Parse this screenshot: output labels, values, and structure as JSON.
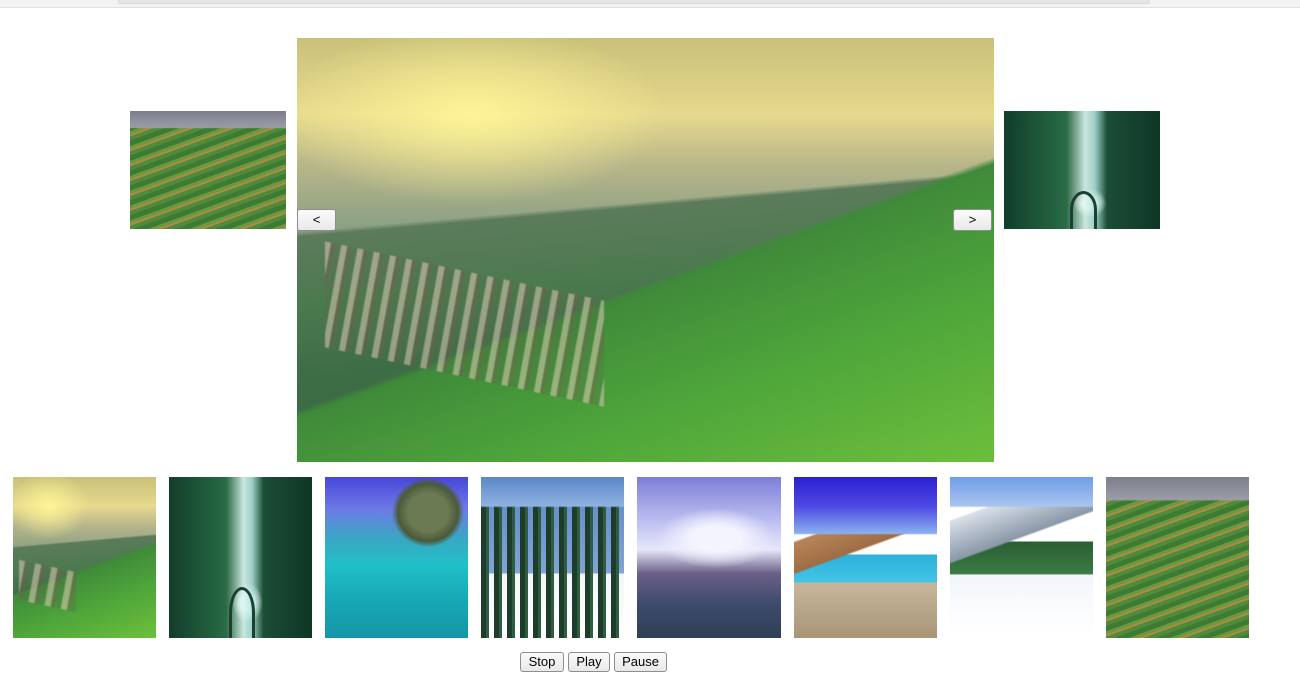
{
  "slideshow": {
    "prev_label": "<",
    "next_label": ">",
    "main_image": "hill-station-tea-garden",
    "prev_preview": "terraced-hillside",
    "next_preview": "waterfall-bridge"
  },
  "thumbnails": [
    {
      "scene": "hill-station-tea-garden"
    },
    {
      "scene": "waterfall-bridge"
    },
    {
      "scene": "tropical-sea-snorkeling"
    },
    {
      "scene": "snow-pine-village"
    },
    {
      "scene": "cloudy-hill-town"
    },
    {
      "scene": "mountain-lake"
    },
    {
      "scene": "snow-peaks-ski"
    },
    {
      "scene": "terraced-hillside"
    }
  ],
  "controls": {
    "stop_label": "Stop",
    "play_label": "Play",
    "pause_label": "Pause"
  }
}
